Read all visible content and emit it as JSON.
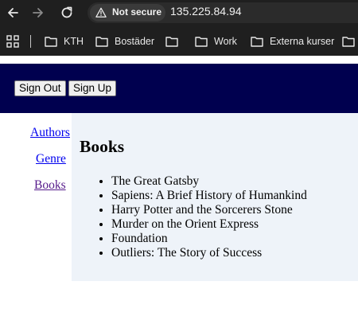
{
  "browser": {
    "security_label": "Not secure",
    "url": "135.225.84.94",
    "bookmarks": [
      {
        "label": "KTH"
      },
      {
        "label": "Bostäder"
      },
      {
        "label": ""
      },
      {
        "label": "Work"
      },
      {
        "label": "Externa kurser"
      },
      {
        "label": ""
      }
    ]
  },
  "header": {
    "sign_out_label": "Sign Out",
    "sign_up_label": "Sign Up"
  },
  "sidebar": {
    "items": [
      {
        "label": "Authors"
      },
      {
        "label": "Genre"
      },
      {
        "label": "Books"
      }
    ]
  },
  "main": {
    "title": "Books",
    "books": [
      "The Great Gatsby",
      "Sapiens: A Brief History of Humankind",
      "Harry Potter and the Sorcerers Stone",
      "Murder on the Orient Express",
      "Foundation",
      "Outliers: The Story of Success"
    ]
  },
  "colors": {
    "chrome_bg": "#1f1f1f",
    "header_bg": "#00004f",
    "main_bg": "#eef3f9",
    "link": "#0000ee",
    "visited_link": "#551a8b"
  }
}
